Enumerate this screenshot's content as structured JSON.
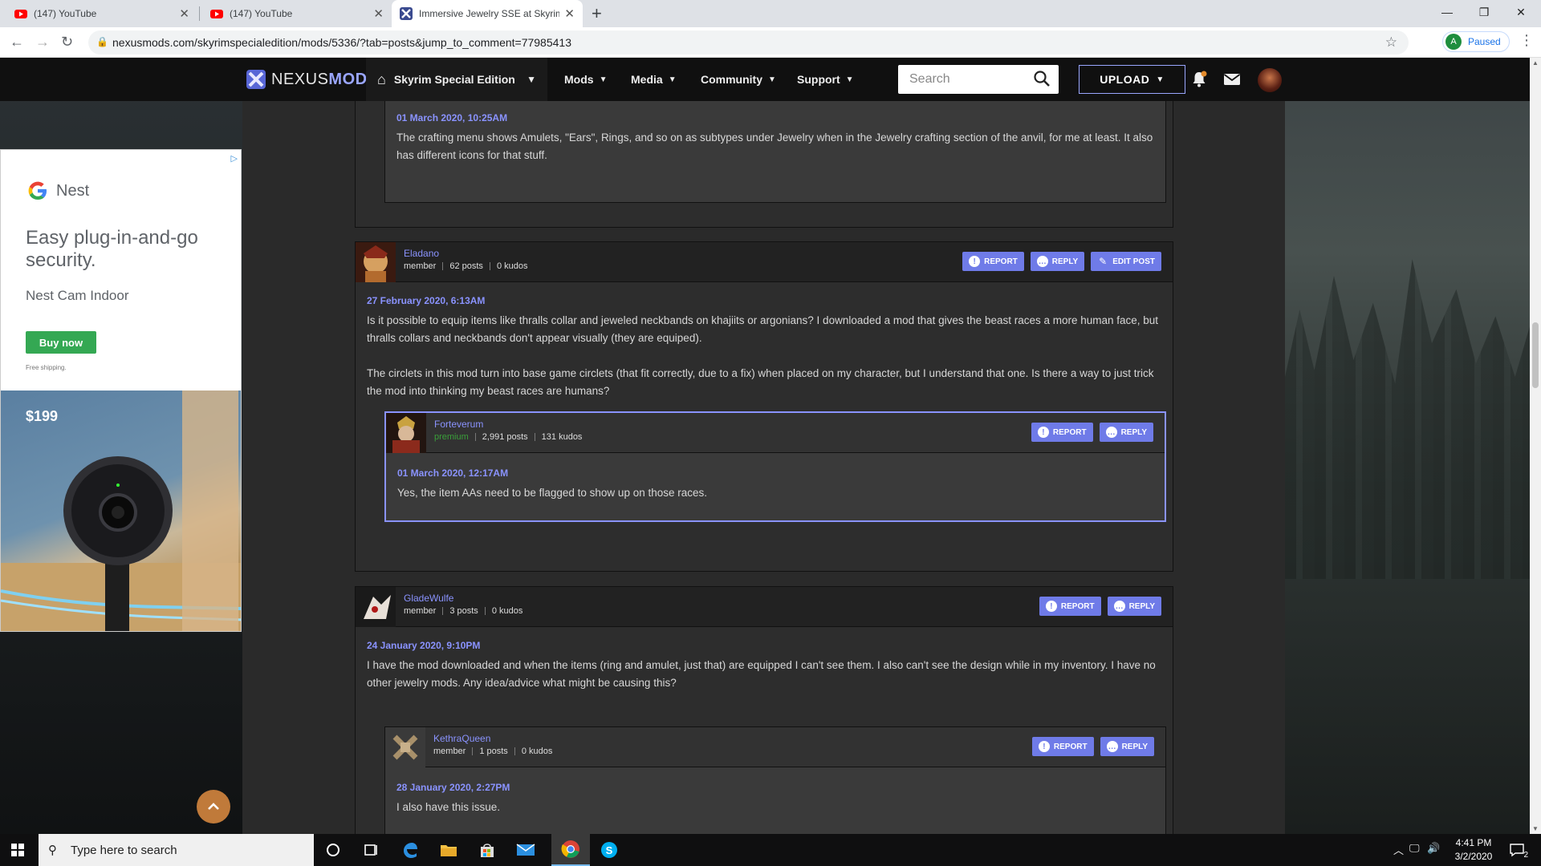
{
  "browser": {
    "tabs": [
      {
        "title": "(147) YouTube",
        "active": false
      },
      {
        "title": "(147) YouTube",
        "active": false
      },
      {
        "title": "Immersive Jewelry SSE at Skyrim",
        "active": true
      }
    ],
    "url": "nexusmods.com/skyrimspecialedition/mods/5336/?tab=posts&jump_to_comment=77985413",
    "profile": {
      "initial": "A",
      "status": "Paused"
    }
  },
  "site": {
    "logo_left": "NEXUS",
    "logo_right": "MODS",
    "game": "Skyrim Special Edition",
    "nav": [
      "Mods",
      "Media",
      "Community",
      "Support"
    ],
    "search_placeholder": "Search",
    "upload": "UPLOAD"
  },
  "ad": {
    "brand": "Nest",
    "headline": "Easy plug-in-and-go security.",
    "sub": "Nest Cam Indoor",
    "button": "Buy now",
    "fine": "Free shipping.",
    "price": "$199"
  },
  "buttons": {
    "report": "REPORT",
    "reply": "REPLY",
    "edit": "EDIT POST"
  },
  "comments": {
    "top_reply": {
      "date": "01 March 2020, 10:25AM",
      "text": "The crafting menu shows Amulets, \"Ears\", Rings, and so on as subtypes under Jewelry when in the Jewelry crafting section of the anvil, for me at least. It also has different icons for that stuff."
    },
    "eladano": {
      "name": "Eladano",
      "role": "member",
      "posts": "62 posts",
      "kudos": "0 kudos",
      "date": "27 February 2020, 6:13AM",
      "p1": "Is it possible to equip items like thralls collar and jeweled neckbands on khajiits or argonians? I downloaded a mod that gives the beast races a more human face, but thralls collars and neckbands don't appear visually (they are equiped).",
      "p2": "The circlets in this mod turn into base game circlets (that fit correctly, due to a fix) when placed on my character, but I understand that one. Is there a way to just trick the mod into thinking my beast races are humans?"
    },
    "forteverum": {
      "name": "Forteverum",
      "role": "premium",
      "posts": "2,991 posts",
      "kudos": "131 kudos",
      "date": "01 March 2020, 12:17AM",
      "text": "Yes, the item AAs need to be flagged to show up on those races."
    },
    "gladewulfe": {
      "name": "GladeWulfe",
      "role": "member",
      "posts": "3 posts",
      "kudos": "0 kudos",
      "date": "24 January 2020, 9:10PM",
      "text": "I have the mod downloaded and when the items (ring and amulet, just that) are equipped I can't see them. I also can't see the design while in my inventory. I have no other jewelry mods. Any idea/advice what might be causing this?"
    },
    "kethraqueen": {
      "name": "KethraQueen",
      "role": "member",
      "posts": "1 posts",
      "kudos": "0 kudos",
      "date": "28 January 2020, 2:27PM",
      "text": "I also have this issue."
    }
  },
  "taskbar": {
    "search_placeholder": "Type here to search",
    "time": "4:41 PM",
    "date": "3/2/2020",
    "notifications": "2"
  }
}
